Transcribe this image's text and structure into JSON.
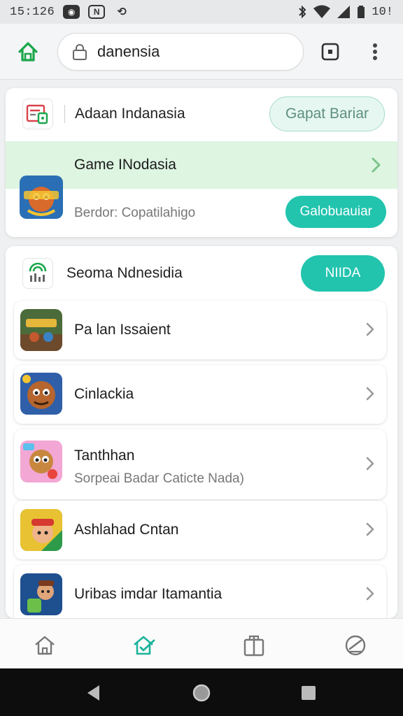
{
  "status_bar": {
    "time": "15:126",
    "battery_text": "10!"
  },
  "browser": {
    "url": "danensia"
  },
  "card1": {
    "header_title": "Adaan Indanasia",
    "header_button": "Gapat Bariar",
    "featured_title": "Game INodasia",
    "featured_subtitle": "Berdor: Copatilahigo",
    "featured_button": "Galobuauiar"
  },
  "card2": {
    "header_title": "Seoma Ndnesidia",
    "header_button": "NIIDA",
    "items": [
      {
        "title": "Pa lan Issaient",
        "subtitle": ""
      },
      {
        "title": "Cinlackia",
        "subtitle": ""
      },
      {
        "title": "Tanthhan",
        "subtitle": "Sorpeai Badar Caticte Nada)"
      },
      {
        "title": "Ashlahad Cntan",
        "subtitle": ""
      },
      {
        "title": "Uribas imdar Itamantia",
        "subtitle": ""
      }
    ]
  },
  "colors": {
    "accent_teal": "#22c4ae",
    "accent_green": "#1aa64a",
    "featured_band": "#ddf5e1"
  },
  "icons": {
    "browser_home": "home-icon",
    "tabs": "tab-switcher-icon",
    "menu": "more-vert-icon",
    "nav": [
      "home-icon",
      "home-check-icon",
      "gift-icon",
      "speedometer-icon"
    ]
  }
}
